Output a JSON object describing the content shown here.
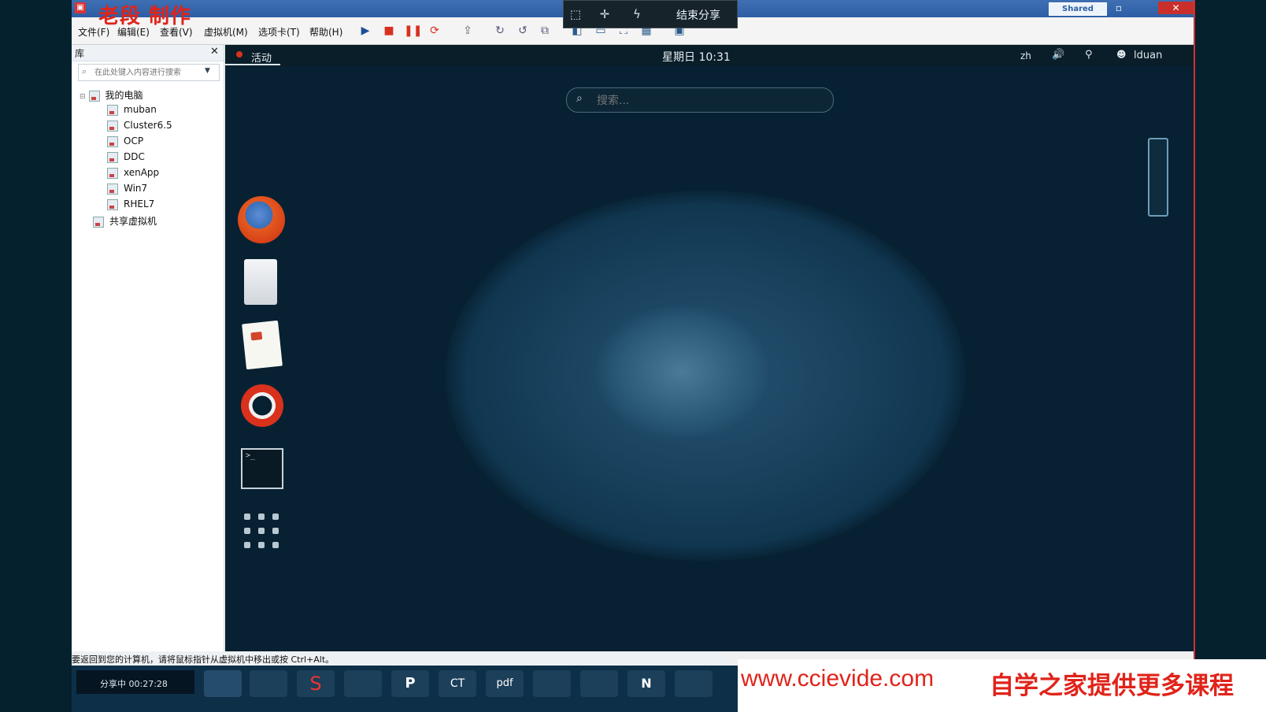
{
  "watermark": "老段 制作",
  "titlebar": {
    "shared": "Shared",
    "minimize": "–",
    "maximize": "▫",
    "close": "✕"
  },
  "share_bar": {
    "end_label": "结束分享"
  },
  "menu": [
    "文件(F)",
    "编辑(E)",
    "查看(V)",
    "虚拟机(M)",
    "选项卡(T)",
    "帮助(H)"
  ],
  "library": {
    "title": "库",
    "close": "✕",
    "search_placeholder": "在此处键入内容进行搜索",
    "root": "我的电脑",
    "vms": [
      "muban",
      "Cluster6.5",
      "OCP",
      "DDC",
      "xenApp",
      "Win7",
      "RHEL7"
    ],
    "shared": "共享虚拟机"
  },
  "guest": {
    "activities": "活动",
    "clock": "星期日 10:31",
    "lang": "zh",
    "user": "lduan",
    "search_placeholder": "搜索..."
  },
  "status": {
    "hint": "要返回到您的计算机，请将鼠标指针从虚拟机中移出或按 Ctrl+Alt。"
  },
  "taskbar": {
    "share_timer": "分享中 00:27:28"
  },
  "ad": {
    "url": "www.ccievide.com",
    "text": "自学之家提供更多课程"
  }
}
